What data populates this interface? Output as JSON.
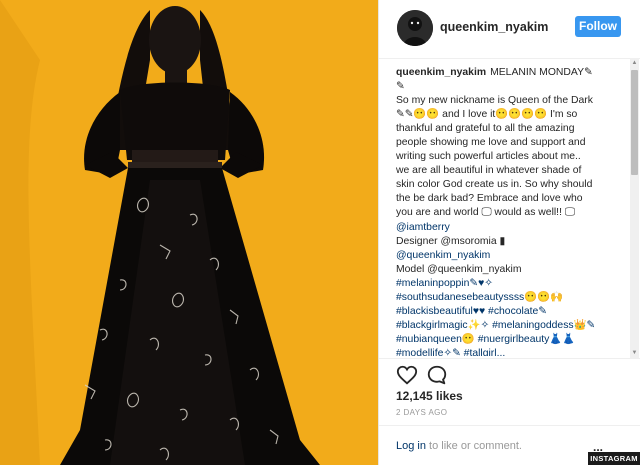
{
  "post": {
    "username": "queenkim_nyakim",
    "follow_label": "Follow",
    "caption_lines": [
      "So my new nickname is Queen of the Dark",
      "✎✎😶😶 and I love it😶😶😶😶 I'm so",
      "thankful and grateful to all the amazing",
      "people showing me love and support and",
      "writing such powerful articles about me..",
      "we are all beautiful in whatever shade of",
      "skin color God create us in. So why should",
      "the be dark bad? Embrace and love who",
      "you are and world 🖵 would as well!! 🖵"
    ],
    "caption_first": "MELANIN MONDAY✎",
    "caption_second": "✎",
    "credits": [
      {
        "text": "@iamtberry",
        "link": true
      },
      {
        "text": "Designer @msoromia ▮",
        "link": false
      },
      {
        "text": "@queenkim_nyakim",
        "link": true
      },
      {
        "text": "Model @queenkim_nyakim",
        "link": false
      },
      {
        "text": "#melaninpoppin✎♥✧",
        "link": true
      },
      {
        "text": "#southsudanesebeautyssss😶😶🙌",
        "link": true
      },
      {
        "text": "#blackisbeautiful♥♥ #chocolate✎",
        "link": true
      },
      {
        "text": "#blackgirlmagic✨✧ #melaningoddess👑✎",
        "link": true
      },
      {
        "text": "#nubianqueen😶 #nuergirlbeauty👗👗",
        "link": true
      },
      {
        "text": "#modellife✧✎ #tallgirl...",
        "link": true
      }
    ],
    "likes": "12,145 likes",
    "date": "2 DAYS AGO",
    "login_link": "Log in",
    "login_rest": " to like or comment.",
    "more_label": "...",
    "watermark": "INSTAGRAM"
  },
  "icons": {
    "like": "heart-icon",
    "comment": "comment-icon",
    "avatar": "profile-photo"
  },
  "colors": {
    "background_photo": "#f2ab1a",
    "follow_button": "#3897f0",
    "link": "#003569",
    "text": "#262626"
  }
}
